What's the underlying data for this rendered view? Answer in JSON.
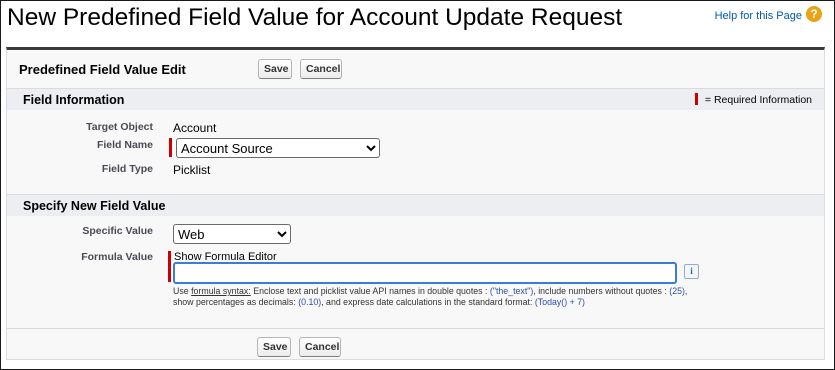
{
  "page": {
    "title": "New Predefined Field Value for Account Update Request",
    "help_link": "Help for this Page",
    "help_icon": "help-icon"
  },
  "edit_block": {
    "title": "Predefined Field Value Edit",
    "save_label": "Save",
    "cancel_label": "Cancel"
  },
  "field_info": {
    "section_title": "Field Information",
    "required_legend": "= Required Information",
    "target_object_label": "Target Object",
    "target_object_value": "Account",
    "field_name_label": "Field Name",
    "field_name_value": "Account Source",
    "field_type_label": "Field Type",
    "field_type_value": "Picklist"
  },
  "new_value": {
    "section_title": "Specify New Field Value",
    "specific_value_label": "Specific Value",
    "specific_value_value": "Web",
    "formula_value_label": "Formula Value",
    "show_formula_editor": "Show Formula Editor",
    "formula_input_value": "",
    "info_button": "i",
    "help": {
      "use": "Use",
      "formula_syntax_link": "formula syntax:",
      "part1": "Enclose text and picklist value API names in double quotes :",
      "example_text": "(\"the_text\")",
      "part2": ", include numbers without quotes :",
      "example_number": "(25)",
      "part3": ", show percentages as decimals:",
      "example_percent": "(0.10)",
      "part4": ", and express date calculations in the standard format:",
      "example_date": "(Today() + 7)"
    }
  },
  "footer": {
    "save_label": "Save",
    "cancel_label": "Cancel"
  },
  "colors": {
    "required": "#cc0000",
    "link": "#015ba7",
    "section_bg": "#eceef2",
    "header_border": "#3a3a3a"
  }
}
